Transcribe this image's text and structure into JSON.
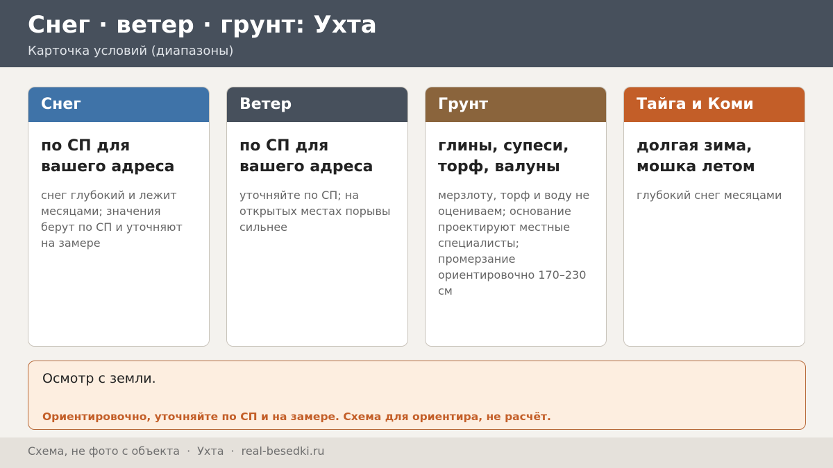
{
  "header": {
    "title": "Снег · ветер · грунт: Ухта",
    "subtitle": "Карточка условий (диапазоны)"
  },
  "cards": [
    {
      "title": "Снег",
      "color": "#3f73a8",
      "main": "по СП для вашего адреса",
      "note": "снег глубокий и лежит месяцами; значения берут по СП и уточняют на замере"
    },
    {
      "title": "Ветер",
      "color": "#47505c",
      "main": "по СП для вашего адреса",
      "note": "уточняйте по СП; на открытых местах порывы сильнее"
    },
    {
      "title": "Грунт",
      "color": "#8a643c",
      "main": "глины, супеси, торф, валуны",
      "note": "мерзлоту, торф и воду не оцениваем; основание проектируют местные специалисты; промерзание ориентировочно 170–230 см"
    },
    {
      "title": "Тайга и Коми",
      "color": "#c35e28",
      "main": "долгая зима, мошка летом",
      "note": "глубокий снег месяцами"
    }
  ],
  "notice": {
    "text": "Осмотр с земли.",
    "warning": "Ориентировочно, уточняйте по СП и на замере. Схема для ориентира, не расчёт."
  },
  "footer": {
    "caption": "Схема, не фото с объекта",
    "city": "Ухта",
    "site": "real-besedki.ru"
  }
}
